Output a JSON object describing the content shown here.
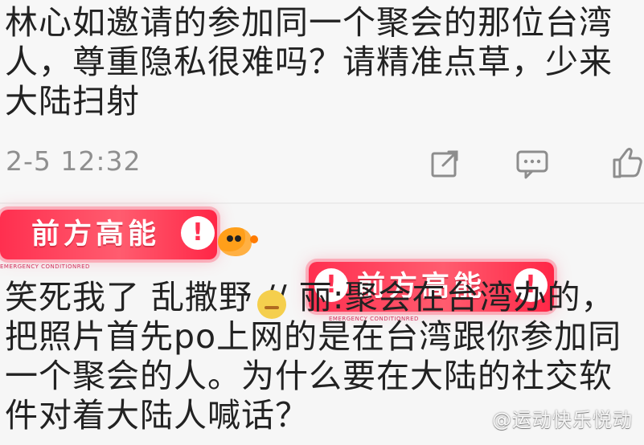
{
  "comment1": {
    "text": "林心如邀请的参加同一个聚会的那位台湾人，尊重隐私很难吗？请精准点草，少来大陆扫射",
    "timestamp": "2-5 12:32"
  },
  "icons": {
    "share": "share-icon",
    "reply": "comment-icon",
    "like": "thumb-up-icon"
  },
  "banner": {
    "title": "前方高能",
    "alert": "!",
    "caption": "EMERGENCY CONDITIONRED"
  },
  "comment2": {
    "text": "笑死我了 乱撒野  //          丽:聚会在台湾办的，把照片首先po上网的是在台湾跟你参加同一个聚会的人。为什么要在大陆的社交软件对着大陆人喊话？"
  },
  "watermark": "@运动快乐悦动"
}
